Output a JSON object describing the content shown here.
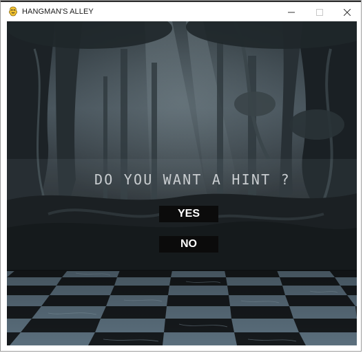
{
  "window": {
    "title": "HANGMAN'S ALLEY",
    "icon": "pygame-snake-icon",
    "controls": {
      "minimize_icon": "minimize-icon",
      "maximize_icon": "maximize-icon",
      "close_icon": "close-icon"
    }
  },
  "game": {
    "prompt": "DO YOU WANT A HINT ?",
    "yes_label": "YES",
    "no_label": "NO",
    "colors": {
      "button_bg": "#0b0b0b",
      "button_text": "#ffffff",
      "prompt_text": "#c9cdd0"
    }
  }
}
